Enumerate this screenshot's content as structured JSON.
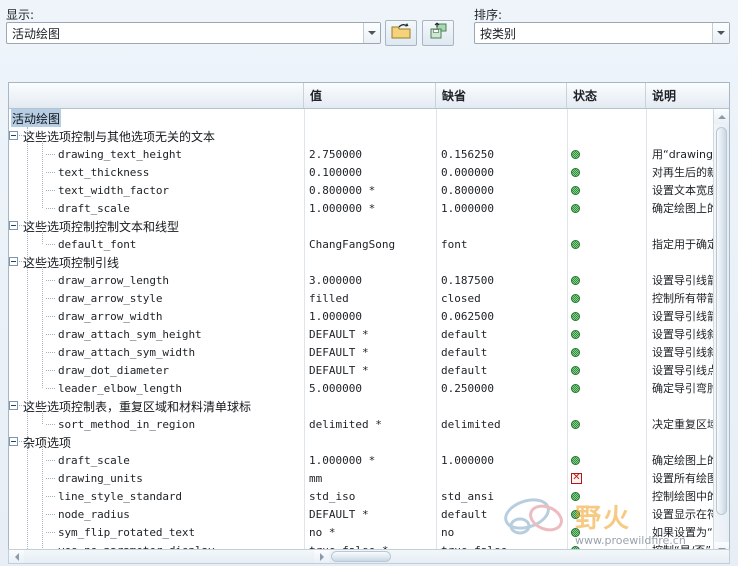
{
  "toolbar": {
    "display_label": "显示:",
    "display_value": "活动绘图",
    "sort_label": "排序:",
    "sort_value": "按类别",
    "open_icon": "open-folder-icon",
    "save_icon": "save-disk-icon"
  },
  "table": {
    "columns": [
      {
        "key": "name",
        "label": ""
      },
      {
        "key": "value",
        "label": "值"
      },
      {
        "key": "def",
        "label": "缺省"
      },
      {
        "key": "status",
        "label": "状态"
      },
      {
        "key": "desc",
        "label": "说明"
      }
    ],
    "selected_row": "活动绘图",
    "rows": [
      {
        "type": "root",
        "name": "活动绘图",
        "value": "",
        "def": "",
        "status": "",
        "desc": ""
      },
      {
        "type": "group",
        "name": "这些选项控制与其他选项无关的文本",
        "value": "",
        "def": "",
        "status": "",
        "desc": ""
      },
      {
        "type": "leaf",
        "name": "drawing_text_height",
        "value": "2.750000",
        "def": "0.156250",
        "status": "ok",
        "desc": "用“drawing_u"
      },
      {
        "type": "leaf",
        "name": "text_thickness",
        "value": "0.100000",
        "def": "0.000000",
        "status": "ok",
        "desc": "对再生后的新"
      },
      {
        "type": "leaf",
        "name": "text_width_factor",
        "value": "0.800000 *",
        "def": "0.800000",
        "status": "ok",
        "desc": "设置文本宽度"
      },
      {
        "type": "leaf",
        "name": "draft_scale",
        "value": "1.000000 *",
        "def": "1.000000",
        "status": "ok",
        "desc": "确定绘图上的"
      },
      {
        "type": "group",
        "name": "这些选项控制控制文本和线型",
        "value": "",
        "def": "",
        "status": "",
        "desc": ""
      },
      {
        "type": "leaf",
        "name": "default_font",
        "value": "ChangFangSong",
        "def": "font",
        "status": "ok",
        "desc": "指定用于确定"
      },
      {
        "type": "group",
        "name": "这些选项控制引线",
        "value": "",
        "def": "",
        "status": "",
        "desc": ""
      },
      {
        "type": "leaf",
        "name": "draw_arrow_length",
        "value": "3.000000",
        "def": "0.187500",
        "status": "ok",
        "desc": "设置导引线箭"
      },
      {
        "type": "leaf",
        "name": "draw_arrow_style",
        "value": "filled",
        "def": "closed",
        "status": "ok",
        "desc": "控制所有带箭"
      },
      {
        "type": "leaf",
        "name": "draw_arrow_width",
        "value": "1.000000",
        "def": "0.062500",
        "status": "ok",
        "desc": "设置导引线箭"
      },
      {
        "type": "leaf",
        "name": "draw_attach_sym_height",
        "value": "DEFAULT *",
        "def": "default",
        "status": "ok",
        "desc": "设置导引线斜"
      },
      {
        "type": "leaf",
        "name": "draw_attach_sym_width",
        "value": "DEFAULT *",
        "def": "default",
        "status": "ok",
        "desc": "设置导引线斜"
      },
      {
        "type": "leaf",
        "name": "draw_dot_diameter",
        "value": "DEFAULT *",
        "def": "default",
        "status": "ok",
        "desc": "设置导引线点"
      },
      {
        "type": "leaf",
        "name": "leader_elbow_length",
        "value": "5.000000",
        "def": "0.250000",
        "status": "ok",
        "desc": "确定导引弯肘"
      },
      {
        "type": "group",
        "name": "这些选项控制表，重复区域和材料清单球标",
        "value": "",
        "def": "",
        "status": "",
        "desc": ""
      },
      {
        "type": "leaf",
        "name": "sort_method_in_region",
        "value": "delimited *",
        "def": "delimited",
        "status": "ok",
        "desc": "决定重复区域"
      },
      {
        "type": "group",
        "name": "杂项选项",
        "value": "",
        "def": "",
        "status": "",
        "desc": ""
      },
      {
        "type": "leaf",
        "name": "draft_scale",
        "value": "1.000000 *",
        "def": "1.000000",
        "status": "ok",
        "desc": "确定绘图上的"
      },
      {
        "type": "leaf",
        "name": "drawing_units",
        "value": "mm",
        "def": "",
        "status": "error",
        "desc": "设置所有绘图"
      },
      {
        "type": "leaf",
        "name": "line_style_standard",
        "value": "std_iso",
        "def": "std_ansi",
        "status": "ok",
        "desc": "控制绘图中的"
      },
      {
        "type": "leaf",
        "name": "node_radius",
        "value": "DEFAULT *",
        "def": "default",
        "status": "ok",
        "desc": "设置显示在符"
      },
      {
        "type": "leaf",
        "name": "sym_flip_rotated_text",
        "value": "no *",
        "def": "no",
        "status": "ok",
        "desc": "如果设置为“是"
      },
      {
        "type": "leaf",
        "name": "yes_no_parameter_display",
        "value": "true_false *",
        "def": "true_false",
        "status": "ok",
        "desc": "控制“是/否”"
      }
    ]
  },
  "watermark": {
    "title": "野火",
    "subtitle": "www.proewildfire.cn"
  },
  "colors": {
    "status_ok": "#2f8f3e",
    "status_error": "#cc1b1b",
    "selection": "#b6cde3",
    "panel_border": "#a9b7c4"
  }
}
